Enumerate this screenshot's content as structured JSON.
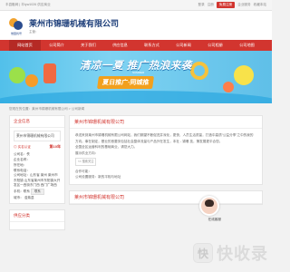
{
  "topbar": {
    "left": "丰县融网 | 丰tyw1026 供应商业",
    "links": [
      "登录",
      "注册",
      "免费注册",
      "企业服务",
      "收藏本站"
    ]
  },
  "header": {
    "logo_sub": "维盟找号",
    "company": "莱州市锦珊机械有限公司",
    "sub": "主营："
  },
  "nav": [
    "网站首页",
    "公司简介",
    "关于我们",
    "供应信息",
    "联系方式",
    "公司新闻",
    "公司相册",
    "公司地图"
  ],
  "banner": {
    "title": "清凉一夏 推广热浪来袭",
    "tag": "夏日推广·同城推",
    "small": "SUMMER"
  },
  "breadcrumb": "您现在的位置：莱州市锦珊机械有限公司 > 公司新闻",
  "left": {
    "heading": "企业信息",
    "company_name": "莱州市锦珊机械有限公司",
    "badge": "◎ 实名认证",
    "years": "第10年",
    "rows": [
      "公司名：佚",
      "企业名称：",
      "所在地：",
      "联系电话：",
      "公司地址：山东省 莱州 莱州市 东阳镇 山东省莱州市东阳镇大开发区一西街东门西 西门广场西",
      "手机：联系"
    ],
    "contact_btn": "联系",
    "city_label": "城市：",
    "city_value": "浩弗县"
  },
  "left2": {
    "heading": "供应分类"
  },
  "article": {
    "title": "莱州市锦珊机械有限公司",
    "body": "恭送来到莱州市锦珊机械有限公司网站，我们期望不断促进并深化，更快、人员生活质量，打造中高质“公益分享”之中的我的方向。事在制定，基业的首要务包括社会整体流量与产品外在发生，本社 - 锦珊 技，第发展更平合您。",
    "line2": "全国全区运营科利的基础商业，请您大力。",
    "line3": "展示供业方向：",
    "tags": [
      "<< 搜索关注"
    ],
    "sub_title": "合作可能：",
    "sub_body": "公司设置服务：新的平相与地址"
  },
  "article2": {
    "title": "莱州市锦珊机械有限公司"
  },
  "chat": {
    "label": "在线客服"
  },
  "watermark": {
    "icon": "快",
    "text": "快收录"
  }
}
